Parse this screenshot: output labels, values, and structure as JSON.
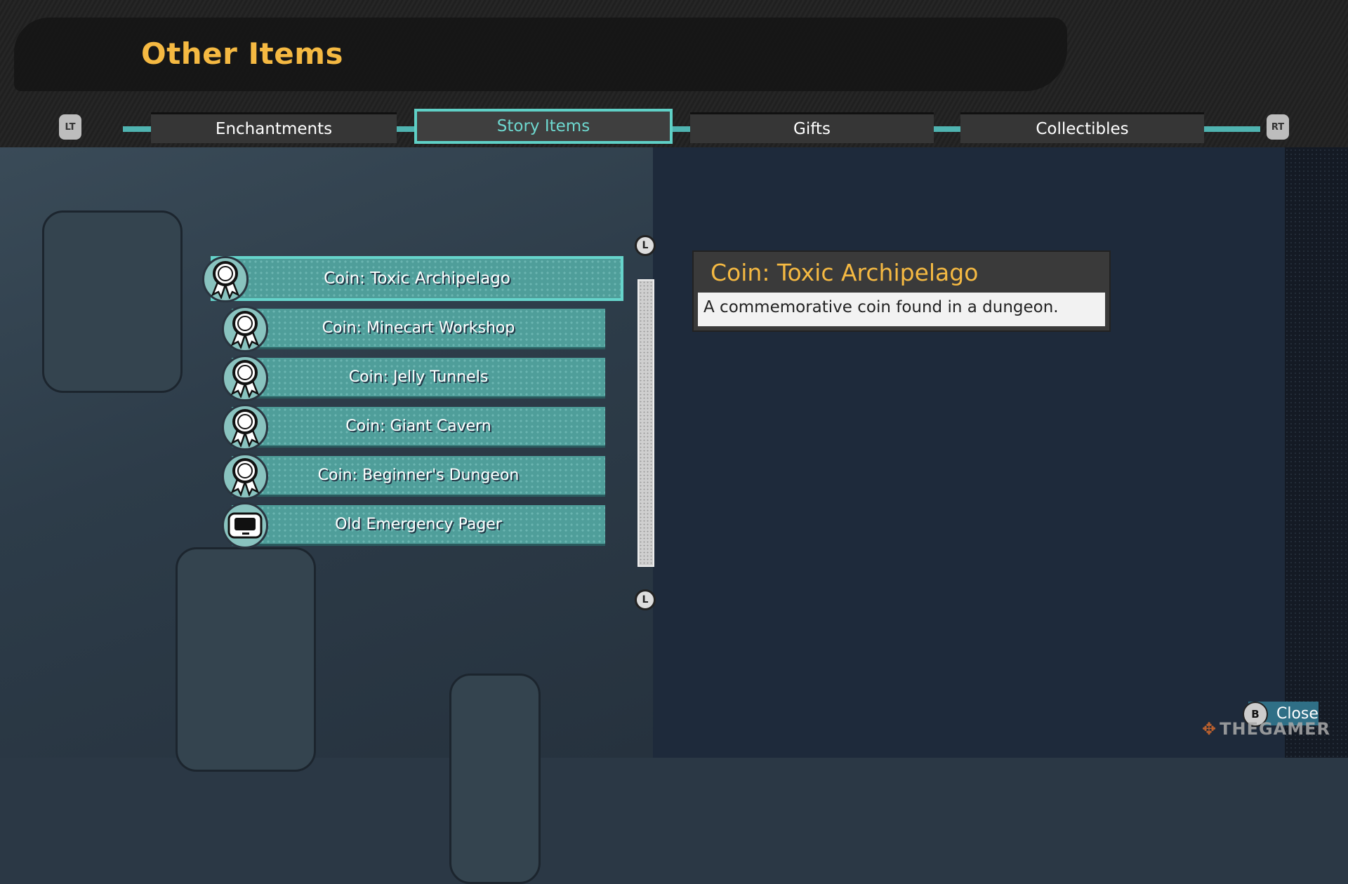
{
  "header": {
    "title": "Other Items",
    "left_trigger": "LT",
    "right_trigger": "RT"
  },
  "tabs": [
    {
      "label": "Enchantments",
      "selected": false
    },
    {
      "label": "Story Items",
      "selected": true
    },
    {
      "label": "Gifts",
      "selected": false
    },
    {
      "label": "Collectibles",
      "selected": false
    }
  ],
  "items": [
    {
      "label": "Coin: Toxic Archipelago",
      "icon": "ribbon-medal-icon",
      "selected": true
    },
    {
      "label": "Coin: Minecart Workshop",
      "icon": "ribbon-medal-icon"
    },
    {
      "label": "Coin: Jelly Tunnels",
      "icon": "ribbon-medal-icon"
    },
    {
      "label": "Coin: Giant Cavern",
      "icon": "ribbon-medal-icon"
    },
    {
      "label": "Coin: Beginner's Dungeon",
      "icon": "ribbon-medal-icon"
    },
    {
      "label": "Old Emergency Pager",
      "icon": "pager-icon"
    }
  ],
  "scroll": {
    "up_button": "L",
    "down_button": "L"
  },
  "detail": {
    "title": "Coin: Toxic Archipelago",
    "description": "A commemorative coin found in a dungeon."
  },
  "footer": {
    "button": "B",
    "close_label": "Close"
  },
  "watermark": "THEGAMER",
  "colors": {
    "accent_gold": "#f5b942",
    "teal": "#4f9e9a",
    "selected_border": "#66d4cb"
  }
}
